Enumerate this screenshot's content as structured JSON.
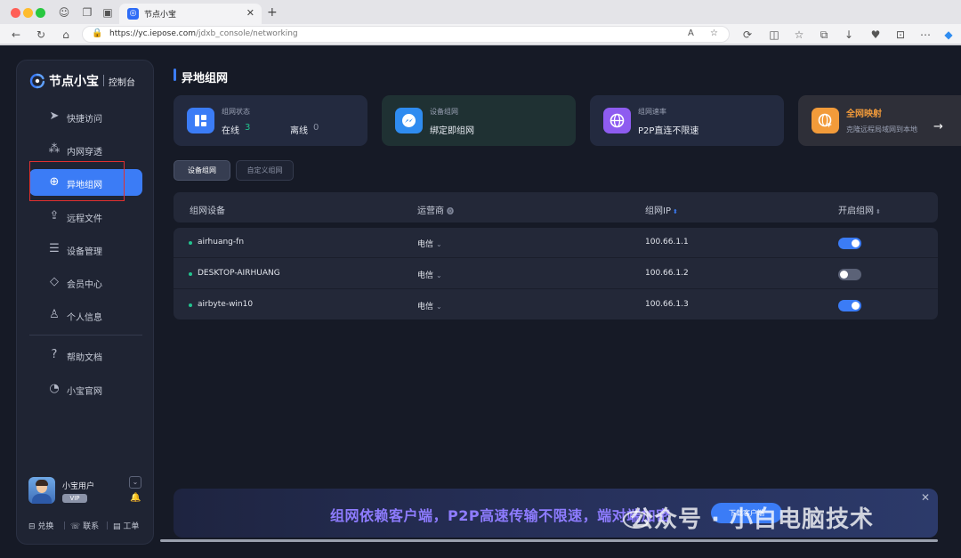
{
  "browser": {
    "tab_title": "节点小宝",
    "url_host": "https://yc.iepose.com",
    "url_path": "/jdxb_console/networking"
  },
  "sidebar": {
    "brand": "节点小宝",
    "brand_sub": "控制台",
    "items": [
      {
        "label": "快捷访问",
        "icon": "send-icon"
      },
      {
        "label": "内网穿透",
        "icon": "network-icon"
      },
      {
        "label": "异地组网",
        "icon": "globe-hand-icon",
        "active": true
      },
      {
        "label": "远程文件",
        "icon": "upload-folder-icon"
      },
      {
        "label": "设备管理",
        "icon": "server-icon"
      },
      {
        "label": "会员中心",
        "icon": "diamond-icon"
      },
      {
        "label": "个人信息",
        "icon": "user-icon"
      },
      {
        "label": "帮助文档",
        "icon": "help-icon"
      },
      {
        "label": "小宝官网",
        "icon": "clock-globe-icon"
      }
    ],
    "user": {
      "name": "小宝用户",
      "badge": "VIP"
    },
    "footer": {
      "exchange": "兑换",
      "contact": "联系",
      "ticket": "工单"
    }
  },
  "main": {
    "title": "异地组网",
    "cards": [
      {
        "title": "组网状态",
        "online_label": "在线",
        "online_count": "3",
        "offline_label": "离线",
        "offline_count": "0",
        "color": "#3b7cf6"
      },
      {
        "title": "设备组网",
        "value": "绑定即组网",
        "color": "#2f8cf0"
      },
      {
        "title": "组网速率",
        "value": "P2P直连不限速",
        "color": "#8e5cf0"
      },
      {
        "title": "全网映射",
        "value": "克隆远程局域网到本地",
        "color": "#f29b3a"
      }
    ],
    "tabs": {
      "device": "设备组网",
      "custom": "自定义组网"
    },
    "table": {
      "headers": {
        "device": "组网设备",
        "carrier": "运营商",
        "ip": "组网IP",
        "enabled": "开启组网"
      },
      "rows": [
        {
          "device": "airhuang-fn",
          "carrier": "电信",
          "ip": "100.66.1.1",
          "enabled": true
        },
        {
          "device": "DESKTOP-AIRHUANG",
          "carrier": "电信",
          "ip": "100.66.1.2",
          "enabled": false
        },
        {
          "device": "airbyte-win10",
          "carrier": "电信",
          "ip": "100.66.1.3",
          "enabled": true
        }
      ]
    },
    "banner": {
      "text": "组网依赖客户端，P2P高速传输不限速，端对端加密",
      "button": "下载客户端"
    },
    "watermark": "公众号 · 小白电脑技术"
  }
}
